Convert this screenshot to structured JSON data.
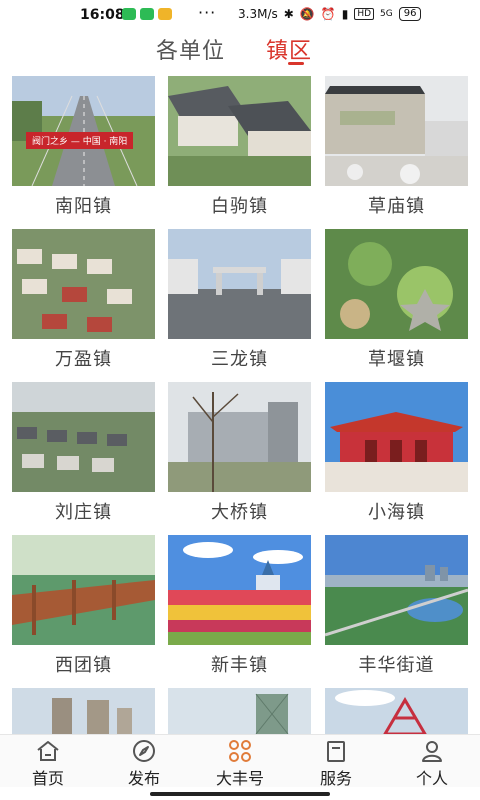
{
  "status": {
    "time": "16:08",
    "speed": "3.3M/s",
    "hd": "HD",
    "signal": "5G",
    "battery": "96"
  },
  "tabs": {
    "units": "各单位",
    "towns": "镇区"
  },
  "banner_text": "阀门之乡 — 中国 · 南阳",
  "towns": [
    "南阳镇",
    "白驹镇",
    "草庙镇",
    "万盈镇",
    "三龙镇",
    "草堰镇",
    "刘庄镇",
    "大桥镇",
    "小海镇",
    "西团镇",
    "新丰镇",
    "丰华街道"
  ],
  "nav": {
    "home": "首页",
    "publish": "发布",
    "dafeng": "大丰号",
    "service": "服务",
    "personal": "个人"
  },
  "colors": {
    "accent": "#d9352b",
    "nav_icon": "#555555",
    "nav_icon_active": "#e07b39"
  },
  "icons": {
    "home": "home-icon",
    "publish": "compass-icon",
    "dafeng": "four-circles-icon",
    "service": "document-icon",
    "personal": "person-icon"
  }
}
